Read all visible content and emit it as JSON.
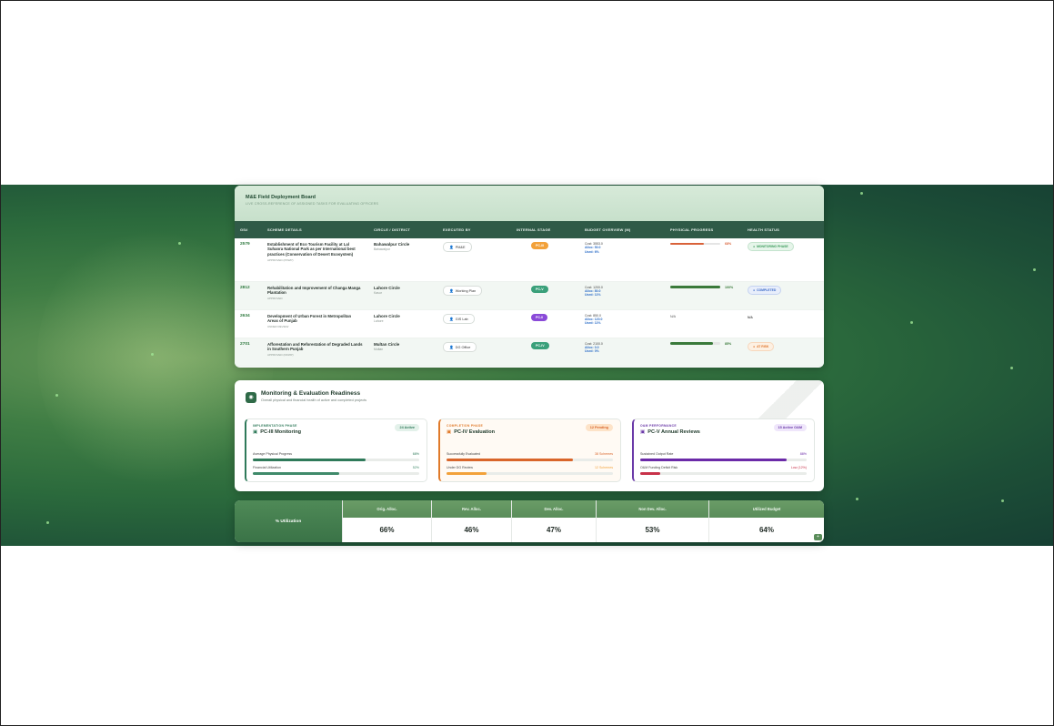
{
  "board": {
    "title": "M&E Field Deployment Board",
    "subtitle": "LIVE CROSS-REFERENCE OF ASSIGNED TASKS FOR EVALUATING OFFICERS",
    "columns": [
      "GS#",
      "SCHEME DETAILS",
      "CIRCLE / DISTRICT",
      "EXECUTED BY",
      "INTERNAL STAGE",
      "BUDGET OVERVIEW (M)",
      "PHYSICAL PROGRESS",
      "HEALTH STATUS"
    ],
    "rows": [
      {
        "gs": "2579",
        "scheme": "Establishment of Eco Tourism Facility at Lal Suhanra National Park as per International best practices (Conservation of Desert Ecosystem)",
        "status": "APPROVED (PDWP)",
        "circle": "Bahawalpur Circle",
        "district": "Bahawalpur",
        "executed_by": "PM&E",
        "stage": "PC-III",
        "stage_color": "#f2a13a",
        "cost": "Cost: 3553.0",
        "alloc": "Alloc: 50.0",
        "used": "Used: 6%",
        "progress": 68,
        "progress_label": "68%",
        "progress_color": "#d9623a",
        "health": "MONITORING PHASE",
        "health_color": "#3a9a5a",
        "health_bg": "#e6f5ea"
      },
      {
        "gs": "2812",
        "scheme": "Rehabilitation and Improvement of Changa Manga Plantation",
        "status": "APPROVED",
        "circle": "Lahore Circle",
        "district": "Kasur",
        "executed_by": "Working Plan",
        "stage": "PC-V",
        "stage_color": "#3aa07a",
        "cost": "Cost: 1200.0",
        "alloc": "Alloc: 80.0",
        "used": "Used: 11%",
        "progress": 100,
        "progress_label": "100%",
        "progress_color": "#3a7a3a",
        "health": "COMPLETED",
        "health_color": "#3a6ac8",
        "health_bg": "#e8eefb"
      },
      {
        "gs": "2634",
        "scheme": "Development of Urban Forest in Metropolitan Areas of Punjab",
        "status": "UNDER REVIEW",
        "circle": "Lahore Circle",
        "district": "Lahore",
        "executed_by": "GIS Lab",
        "stage": "PC-II",
        "stage_color": "#8a4ad8",
        "cost": "Cost: 850.0",
        "alloc": "Alloc: 120.0",
        "used": "Used: 11%",
        "progress": null,
        "progress_label": "N/A",
        "progress_color": "#3a7a3a",
        "health": "N/A",
        "health_color": "#555555",
        "health_bg": "transparent"
      },
      {
        "gs": "2701",
        "scheme": "Afforestation and Reforestation of Degraded Lands in Southern Punjab",
        "status": "APPROVED (DDWP)",
        "circle": "Multan Circle",
        "district": "Multan",
        "executed_by": "DG Office",
        "stage": "PC-IV",
        "stage_color": "#3aa07a",
        "cost": "Cost: 2100.0",
        "alloc": "Alloc: 0.0",
        "used": "Used: 0%",
        "progress": 85,
        "progress_label": "85%",
        "progress_color": "#3a7a3a",
        "health": "AT RISK",
        "health_color": "#e0752a",
        "health_bg": "#fdf0e2"
      }
    ]
  },
  "readiness": {
    "title": "Monitoring & Evaluation Readiness",
    "subtitle": "Overall physical and financial health of active and completed projects",
    "cards": [
      {
        "phase": "IMPLEMENTATION PHASE",
        "phase_color": "#2f7a5a",
        "title": "PC-III Monitoring",
        "badge": "24 Active",
        "badge_color": "#2f7a5a",
        "badge_bg": "#e3f1ea",
        "m1_label": "Average Physical Progress",
        "m1_value": "68%",
        "m1_pct": 68,
        "m1_color": "#2f7a5a",
        "m2_label": "Financial Utilization",
        "m2_value": "52%",
        "m2_pct": 52,
        "m2_color": "#3f8a6a"
      },
      {
        "phase": "COMPLETION PHASE",
        "phase_color": "#e07a2a",
        "title": "PC-IV Evaluation",
        "badge": "12 Pending",
        "badge_color": "#d9652a",
        "badge_bg": "#fde3c8",
        "m1_label": "Successfully Evaluated",
        "m1_value": "38 Schemes",
        "m1_pct": 76,
        "m1_color": "#d9652a",
        "m2_label": "Under DG Review",
        "m2_value": "12 Schemes",
        "m2_pct": 24,
        "m2_color": "#f2a13a"
      },
      {
        "phase": "O&M PERFORMANCE",
        "phase_color": "#6b3aa8",
        "title": "PC-V Annual Reviews",
        "badge": "15 Active O&M",
        "badge_color": "#6b3aa8",
        "badge_bg": "#efe6fb",
        "m1_label": "Sustained Output Rate",
        "m1_value": "88%",
        "m1_pct": 88,
        "m1_color": "#6b2aa8",
        "m2_label": "O&M Funding Deficit Risk",
        "m2_value": "Low (12%)",
        "m2_pct": 12,
        "m2_color": "#c8324a"
      }
    ]
  },
  "utilization": {
    "label": "% Utilization",
    "columns": [
      {
        "header": "Orig. Alloc.",
        "value": "66%"
      },
      {
        "header": "Rev. Alloc.",
        "value": "46%"
      },
      {
        "header": "Dev. Alloc.",
        "value": "47%"
      },
      {
        "header": "Non Dev. Alloc.",
        "value": "53%"
      },
      {
        "header": "Utilized Budget",
        "value": "64%"
      }
    ]
  }
}
